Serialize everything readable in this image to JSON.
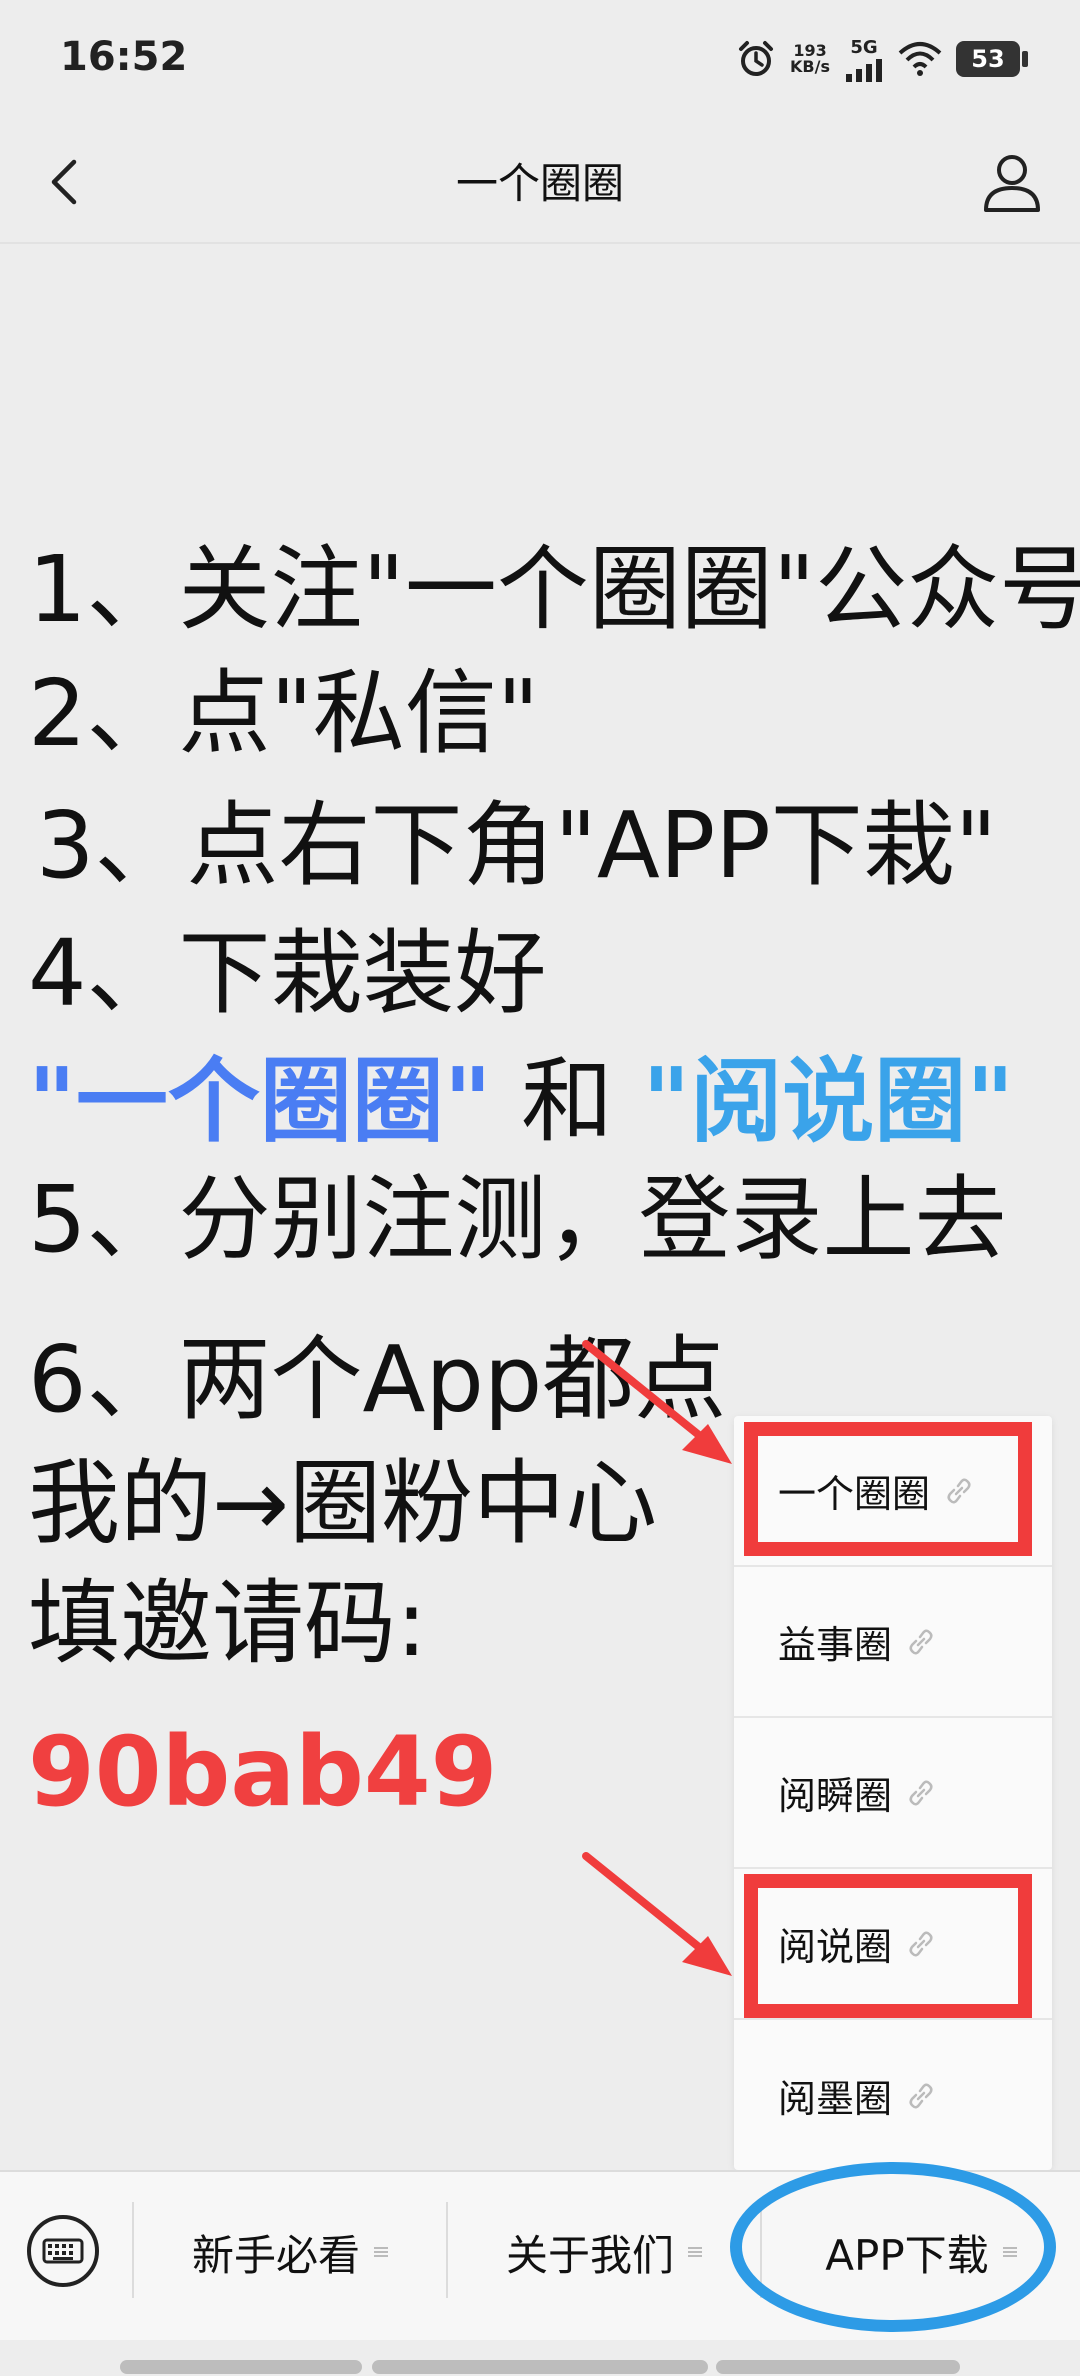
{
  "status_bar": {
    "time": "16:52",
    "speed_value": "193",
    "speed_unit": "KB/s",
    "network": "5G",
    "battery": "53",
    "icons": [
      "alarm-icon",
      "signal-icon",
      "wifi-icon",
      "battery-icon"
    ]
  },
  "nav": {
    "title": "一个圈圈",
    "back_icon": "chevron-left-icon",
    "profile_icon": "person-icon"
  },
  "article": {
    "line1": "1、关注\"一个圈圈\"公众号",
    "line2": "2、点\"私信\"",
    "line3": "3、点右下角\"APP下栽\"",
    "line4": "4、下栽装好",
    "line5_a": "\"一个圈圈\"",
    "line5_mid": " 和 ",
    "line5_b": "\"阅说圈\"",
    "line6": "5、分别注测，登录上去",
    "line7": "6、两个App都点",
    "line8": "我的→圈粉中心",
    "line9": "填邀请码:",
    "code": "90bab49"
  },
  "popup_menu": {
    "items": [
      {
        "label": "一个圈圈"
      },
      {
        "label": "益事圈"
      },
      {
        "label": "阅瞬圈"
      },
      {
        "label": "阅说圈"
      },
      {
        "label": "阅墨圈"
      }
    ]
  },
  "bottom_menu": {
    "tabs": [
      {
        "label": "新手必看"
      },
      {
        "label": "关于我们"
      },
      {
        "label": "APP下载"
      }
    ]
  },
  "colors": {
    "highlight_red": "#f03c3c",
    "ellipse_blue": "#2d9be6",
    "text_blue_a": "#4a7df3",
    "text_blue_b": "#3aa3ea",
    "code_red": "#f04040"
  }
}
